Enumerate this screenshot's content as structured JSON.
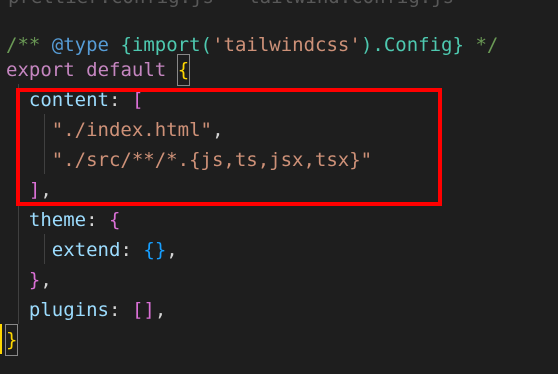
{
  "editor": {
    "partial_top_line": "prettier.config.js • tailwind.config.js",
    "lines": [
      {
        "segments": [
          {
            "text": "/** ",
            "color": "#6a9955"
          },
          {
            "text": "@type",
            "color": "#569cd6"
          },
          {
            "text": " {import(",
            "color": "#4ec9b0"
          },
          {
            "text": "'tailwindcss'",
            "color": "#ce9178"
          },
          {
            "text": ").Config}",
            "color": "#4ec9b0"
          },
          {
            "text": " */",
            "color": "#6a9955"
          }
        ]
      },
      {
        "segments": [
          {
            "text": "export",
            "color": "#c586c0"
          },
          {
            "text": " ",
            "color": "#d4d4d4"
          },
          {
            "text": "default",
            "color": "#c586c0"
          },
          {
            "text": " ",
            "color": "#d4d4d4"
          },
          {
            "text": "{",
            "color": "#ffd700"
          }
        ]
      },
      {
        "segments": [
          {
            "text": "  ",
            "color": "#d4d4d4"
          },
          {
            "text": "content",
            "color": "#9cdcfe"
          },
          {
            "text": ": ",
            "color": "#d4d4d4"
          },
          {
            "text": "[",
            "color": "#da70d6"
          }
        ]
      },
      {
        "segments": [
          {
            "text": "    ",
            "color": "#d4d4d4"
          },
          {
            "text": "\"./index.html\"",
            "color": "#ce9178"
          },
          {
            "text": ",",
            "color": "#d4d4d4"
          }
        ]
      },
      {
        "segments": [
          {
            "text": "    ",
            "color": "#d4d4d4"
          },
          {
            "text": "\"./src/**/*.{js,ts,jsx,tsx}\"",
            "color": "#ce9178"
          }
        ]
      },
      {
        "segments": [
          {
            "text": "  ",
            "color": "#d4d4d4"
          },
          {
            "text": "]",
            "color": "#da70d6"
          },
          {
            "text": ",",
            "color": "#d4d4d4"
          }
        ]
      },
      {
        "segments": [
          {
            "text": "  ",
            "color": "#d4d4d4"
          },
          {
            "text": "theme",
            "color": "#9cdcfe"
          },
          {
            "text": ": ",
            "color": "#d4d4d4"
          },
          {
            "text": "{",
            "color": "#da70d6"
          }
        ]
      },
      {
        "segments": [
          {
            "text": "    ",
            "color": "#d4d4d4"
          },
          {
            "text": "extend",
            "color": "#9cdcfe"
          },
          {
            "text": ": ",
            "color": "#d4d4d4"
          },
          {
            "text": "{}",
            "color": "#179fff"
          },
          {
            "text": ",",
            "color": "#d4d4d4"
          }
        ]
      },
      {
        "segments": [
          {
            "text": "  ",
            "color": "#d4d4d4"
          },
          {
            "text": "}",
            "color": "#da70d6"
          },
          {
            "text": ",",
            "color": "#d4d4d4"
          }
        ]
      },
      {
        "segments": [
          {
            "text": "  ",
            "color": "#d4d4d4"
          },
          {
            "text": "plugins",
            "color": "#9cdcfe"
          },
          {
            "text": ": ",
            "color": "#d4d4d4"
          },
          {
            "text": "[]",
            "color": "#da70d6"
          },
          {
            "text": ",",
            "color": "#d4d4d4"
          }
        ]
      },
      {
        "segments": [
          {
            "text": "}",
            "color": "#ffd700"
          }
        ]
      }
    ]
  },
  "highlight": {
    "color": "#ff0000"
  },
  "colors": {
    "background": "#1e1e1e",
    "bracket_gold": "#ffd700",
    "bracket_purple": "#da70d6",
    "bracket_blue": "#179fff"
  }
}
